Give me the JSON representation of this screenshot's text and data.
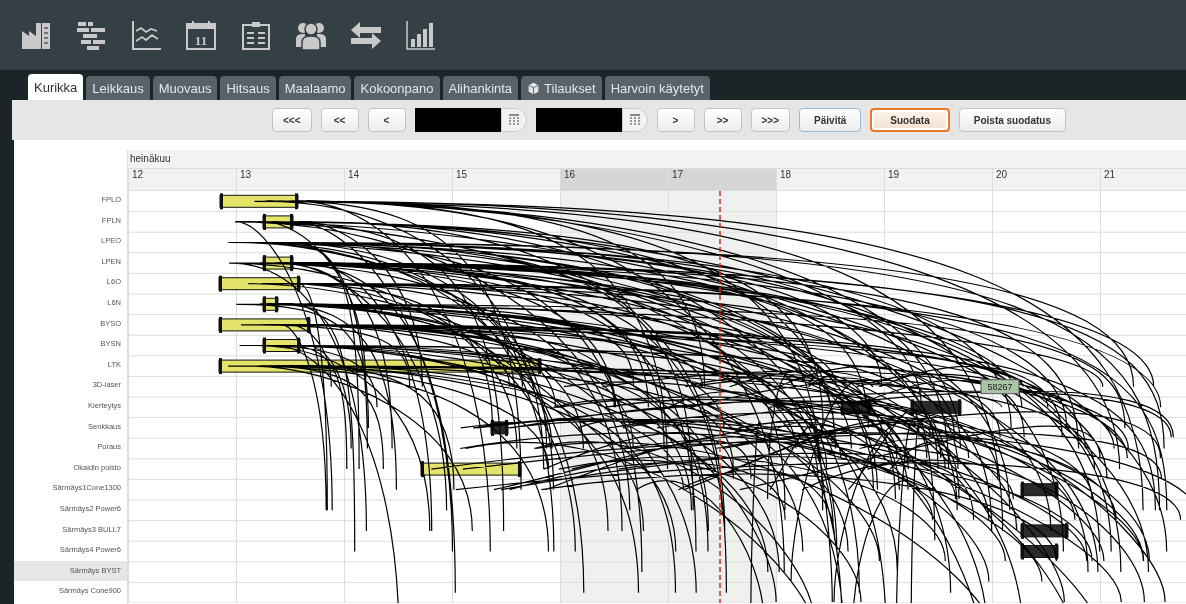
{
  "toolbar": {
    "calendar_day": "11"
  },
  "tabs": [
    {
      "label": "Kurikka",
      "selected": true,
      "kind": "plain"
    },
    {
      "label": "Leikkaus",
      "selected": false,
      "kind": "plain"
    },
    {
      "label": "Muovaus",
      "selected": false,
      "kind": "plain"
    },
    {
      "label": "Hitsaus",
      "selected": false,
      "kind": "plain"
    },
    {
      "label": "Maalaamo",
      "selected": false,
      "kind": "plain"
    },
    {
      "label": "Kokoonpano",
      "selected": false,
      "kind": "plain"
    },
    {
      "label": "Alihankinta",
      "selected": false,
      "kind": "plain"
    },
    {
      "label": "Tilaukset",
      "selected": false,
      "kind": "with-icon"
    },
    {
      "label": "Harvoin käytetyt",
      "selected": false,
      "kind": "plain"
    }
  ],
  "navigation": {
    "back_buttons": [
      "<<<",
      "<<",
      "<"
    ],
    "date_fields": [
      {
        "redacted": true
      },
      {
        "redacted": true
      }
    ],
    "forward_buttons": [
      ">",
      ">>",
      ">>>"
    ],
    "actions": [
      {
        "label": "Päivitä",
        "focused": true,
        "selected": false
      },
      {
        "label": "Suodata",
        "focused": false,
        "selected": true
      },
      {
        "label": "Poista suodatus",
        "focused": false,
        "selected": false
      }
    ]
  },
  "gantt": {
    "month": "heinäkuu",
    "days": [
      "12",
      "13",
      "14",
      "15",
      "16",
      "17",
      "18",
      "19",
      "20",
      "21"
    ],
    "bar_label": "58267",
    "rows": [
      {
        "label": "FPLO",
        "selected": false
      },
      {
        "label": "FPLN",
        "selected": false
      },
      {
        "label": "LPEO",
        "selected": false
      },
      {
        "label": "LPEN",
        "selected": false
      },
      {
        "label": "L6O",
        "selected": false
      },
      {
        "label": "L6N",
        "selected": false
      },
      {
        "label": "BYSO",
        "selected": false
      },
      {
        "label": "BYSN",
        "selected": false
      },
      {
        "label": "LTK",
        "selected": false
      },
      {
        "label": "3D-laser",
        "selected": false
      },
      {
        "label": "Kierteytys",
        "selected": false
      },
      {
        "label": "Senkkaus",
        "selected": false
      },
      {
        "label": "Poraus",
        "selected": false
      },
      {
        "label": "Okaidin poisto",
        "selected": false
      },
      {
        "label": "Särmäys1Cone1300",
        "selected": false
      },
      {
        "label": "Särmäys2 Power6",
        "selected": false
      },
      {
        "label": "Särmäys3 BULL7",
        "selected": false
      },
      {
        "label": "Särmäys4 Power6",
        "selected": false
      },
      {
        "label": "Särmäys BYST",
        "selected": true
      },
      {
        "label": "Särmäys Cone900",
        "selected": false
      }
    ]
  }
}
